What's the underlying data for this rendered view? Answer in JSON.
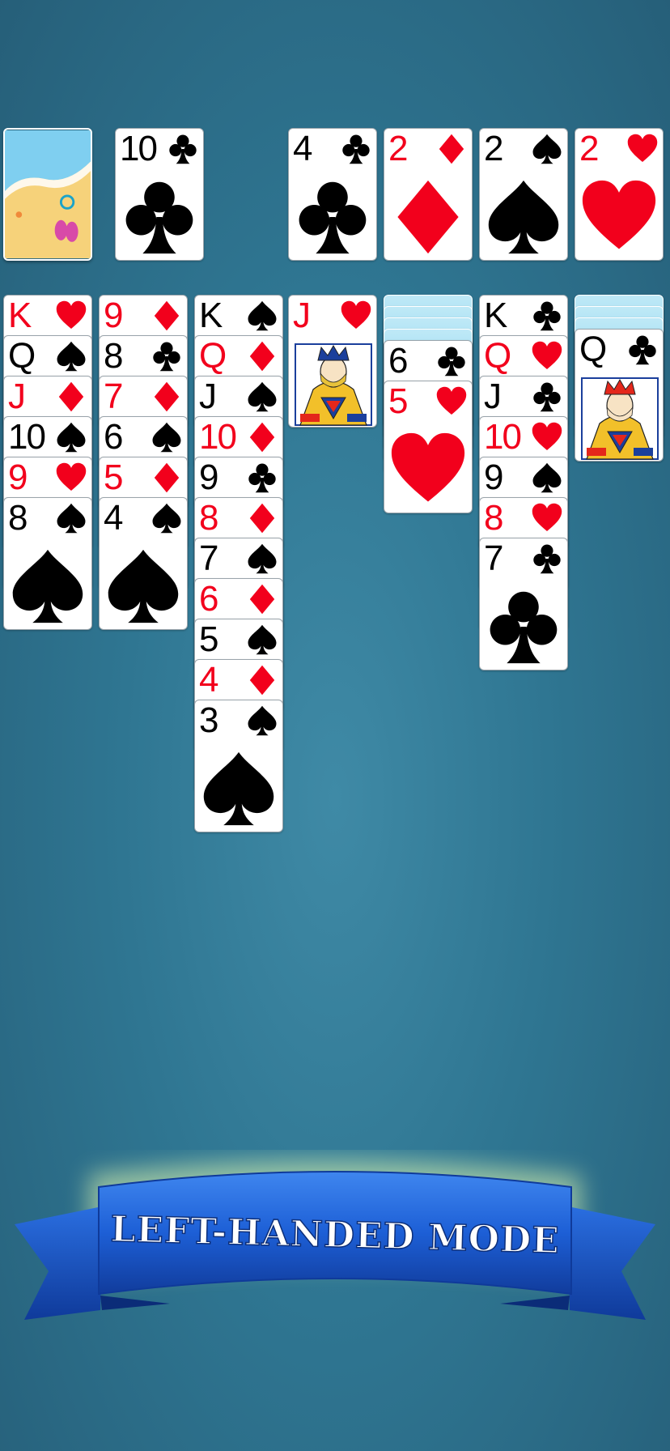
{
  "suit_icons": {
    "S": "spade-icon",
    "H": "heart-icon",
    "D": "diamond-icon",
    "C": "club-icon"
  },
  "colors": {
    "table": "#2f7692",
    "red": "#f2001c",
    "black": "#000000",
    "banner_blue": "#1a56c9"
  },
  "stock": {
    "name": "card-back-beach"
  },
  "waste": [
    {
      "rank": "10",
      "suit": "C"
    }
  ],
  "foundations": [
    {
      "rank": "4",
      "suit": "C"
    },
    {
      "rank": "2",
      "suit": "D"
    },
    {
      "rank": "2",
      "suit": "S"
    },
    {
      "rank": "2",
      "suit": "H"
    }
  ],
  "tableau": [
    {
      "hidden": 0,
      "cards": [
        {
          "rank": "K",
          "suit": "H"
        },
        {
          "rank": "Q",
          "suit": "S"
        },
        {
          "rank": "J",
          "suit": "D"
        },
        {
          "rank": "10",
          "suit": "S"
        },
        {
          "rank": "9",
          "suit": "H"
        },
        {
          "rank": "8",
          "suit": "S"
        }
      ]
    },
    {
      "hidden": 0,
      "cards": [
        {
          "rank": "9",
          "suit": "D"
        },
        {
          "rank": "8",
          "suit": "C"
        },
        {
          "rank": "7",
          "suit": "D"
        },
        {
          "rank": "6",
          "suit": "S"
        },
        {
          "rank": "5",
          "suit": "D"
        },
        {
          "rank": "4",
          "suit": "S"
        }
      ]
    },
    {
      "hidden": 0,
      "cards": [
        {
          "rank": "K",
          "suit": "S"
        },
        {
          "rank": "Q",
          "suit": "D"
        },
        {
          "rank": "J",
          "suit": "S"
        },
        {
          "rank": "10",
          "suit": "D"
        },
        {
          "rank": "9",
          "suit": "C"
        },
        {
          "rank": "8",
          "suit": "D"
        },
        {
          "rank": "7",
          "suit": "S"
        },
        {
          "rank": "6",
          "suit": "D"
        },
        {
          "rank": "5",
          "suit": "S"
        },
        {
          "rank": "4",
          "suit": "D"
        },
        {
          "rank": "3",
          "suit": "S"
        }
      ]
    },
    {
      "hidden": 0,
      "cards": [
        {
          "rank": "J",
          "suit": "H"
        }
      ]
    },
    {
      "hidden": 4,
      "cards": [
        {
          "rank": "6",
          "suit": "C"
        },
        {
          "rank": "5",
          "suit": "H"
        }
      ]
    },
    {
      "hidden": 0,
      "cards": [
        {
          "rank": "K",
          "suit": "C"
        },
        {
          "rank": "Q",
          "suit": "H"
        },
        {
          "rank": "J",
          "suit": "C"
        },
        {
          "rank": "10",
          "suit": "H"
        },
        {
          "rank": "9",
          "suit": "S"
        },
        {
          "rank": "8",
          "suit": "H"
        },
        {
          "rank": "7",
          "suit": "C"
        }
      ]
    },
    {
      "hidden": 3,
      "cards": [
        {
          "rank": "Q",
          "suit": "C"
        }
      ]
    }
  ],
  "banner": {
    "text": "LEFT-HANDED MODE"
  }
}
